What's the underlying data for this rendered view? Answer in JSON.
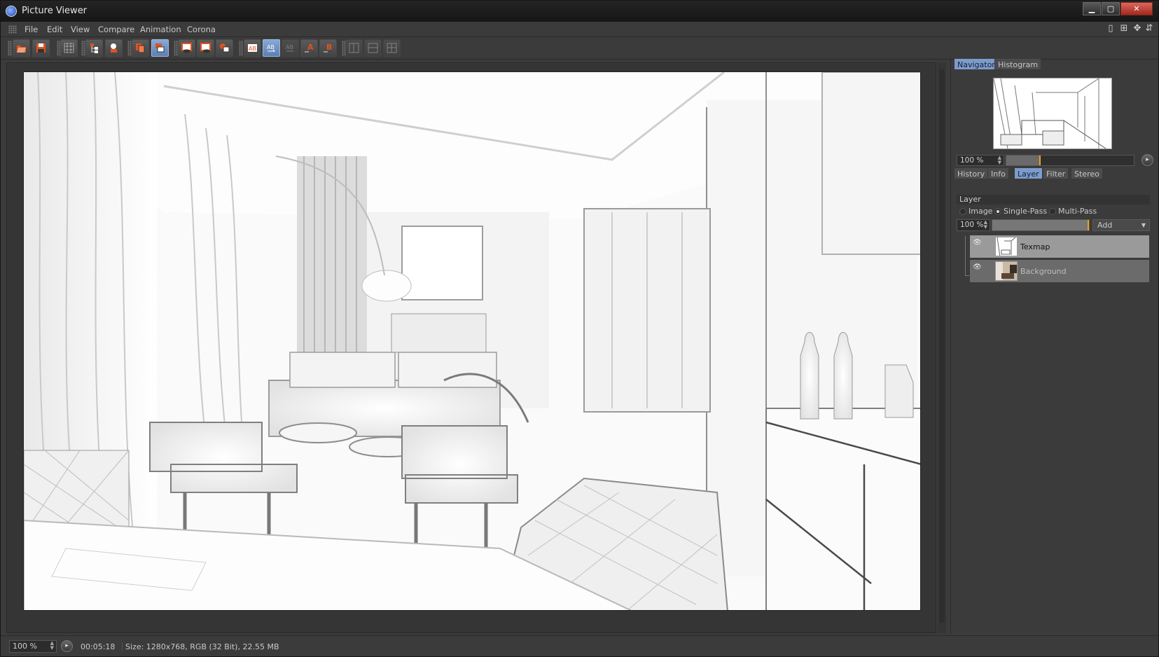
{
  "window": {
    "title": "Picture Viewer",
    "minimize": "▁",
    "maximize": "▢",
    "close": "✕"
  },
  "menu": {
    "items": [
      "File",
      "Edit",
      "View",
      "Compare",
      "Animation",
      "Corona"
    ]
  },
  "toolbar": {
    "buttons": [
      {
        "name": "open-icon",
        "state": "normal"
      },
      {
        "name": "save-icon",
        "state": "normal"
      },
      {
        "name": "grid-icon",
        "state": "normal"
      },
      {
        "name": "hierarchy-icon",
        "state": "normal"
      },
      {
        "name": "user-render-icon",
        "state": "normal"
      },
      {
        "name": "copy-icon",
        "state": "normal"
      },
      {
        "name": "stack-icon",
        "state": "active"
      },
      {
        "name": "region-eye-icon",
        "state": "normal"
      },
      {
        "name": "region-eye-2-icon",
        "state": "normal"
      },
      {
        "name": "region-eye-3-icon",
        "state": "normal"
      },
      {
        "name": "ab-compare-icon",
        "state": "normal"
      },
      {
        "name": "ab-swap-icon",
        "state": "active"
      },
      {
        "name": "ab-disabled-icon",
        "state": "disabled"
      },
      {
        "name": "set-a-icon",
        "state": "normal",
        "label": "A"
      },
      {
        "name": "set-b-icon",
        "state": "normal",
        "label": "B"
      },
      {
        "name": "ab-split-1-icon",
        "state": "disabled"
      },
      {
        "name": "ab-split-2-icon",
        "state": "disabled"
      },
      {
        "name": "ab-split-3-icon",
        "state": "disabled"
      }
    ]
  },
  "navigator": {
    "tabs": [
      {
        "label": "Navigator",
        "active": true
      },
      {
        "label": "Histogram",
        "active": false
      }
    ],
    "zoom": "100 %",
    "zoom_fraction": 0.26
  },
  "panel": {
    "tabs": [
      {
        "label": "History",
        "active": false
      },
      {
        "label": "Info",
        "active": false
      },
      {
        "label": "Layer",
        "active": true
      },
      {
        "label": "Filter",
        "active": false
      },
      {
        "label": "Stereo",
        "active": false
      }
    ],
    "layer_header": "Layer",
    "modes": [
      {
        "label": "Image",
        "selected": false
      },
      {
        "label": "Single-Pass",
        "selected": true
      },
      {
        "label": "Multi-Pass",
        "selected": false
      }
    ],
    "opacity": "100 %",
    "add_label": "Add",
    "layers": [
      {
        "name": "Texmap",
        "selected": true
      },
      {
        "name": "Background",
        "selected": false
      }
    ]
  },
  "status": {
    "zoom": "100 %",
    "time": "00:05:18",
    "size": "Size: 1280x768, RGB (32 Bit), 22.55 MB"
  },
  "colors": {
    "accent": "#7e9ccb",
    "orange": "#e0531f",
    "marker": "#f0a020"
  }
}
